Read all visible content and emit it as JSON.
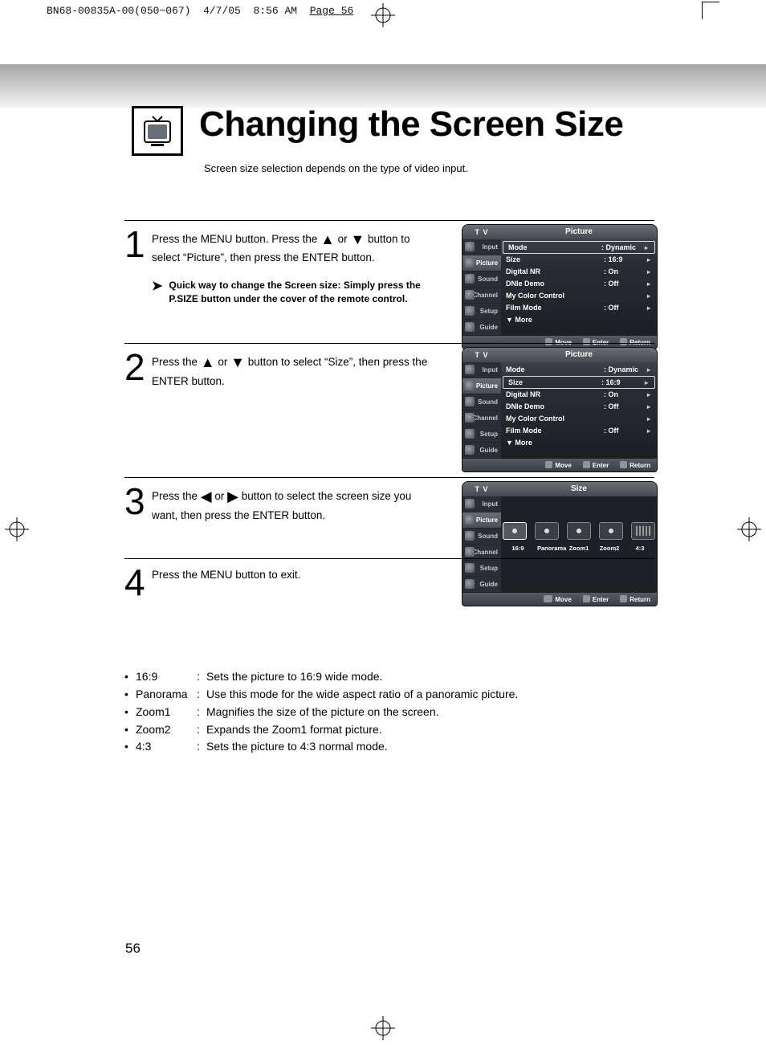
{
  "print_header": {
    "doc": "BN68-00835A-00(050~067)",
    "date": "4/7/05",
    "time": "8:56 AM",
    "page": "Page 56"
  },
  "title": "Changing the Screen Size",
  "subtitle": "Screen size selection depends on the type of video input.",
  "steps": {
    "s1": {
      "num": "1",
      "text_a": "Press the MENU button. Press the ",
      "text_b": " or ",
      "text_c": " button to select “Picture”, then press the ENTER button."
    },
    "tip": "Quick way to change the Screen size: Simply press the P.SIZE button under the cover of the remote control.",
    "s2": {
      "num": "2",
      "text_a": "Press the ",
      "text_b": " or ",
      "text_c": " button to select “Size”, then press the ENTER button."
    },
    "s3": {
      "num": "3",
      "text_a": "Press the ",
      "text_b": " or ",
      "text_c": " button to select the screen size you want, then press the ENTER button."
    },
    "s4": {
      "num": "4",
      "text": "Press the MENU button to exit."
    }
  },
  "osd": {
    "tv": "T V",
    "picture_title": "Picture",
    "size_title": "Size",
    "side": [
      "Input",
      "Picture",
      "Sound",
      "Channel",
      "Setup",
      "Guide"
    ],
    "rows": [
      {
        "lab": "Mode",
        "val": ": Dynamic",
        "chev": "▸"
      },
      {
        "lab": "Size",
        "val": ": 16:9",
        "chev": "▸"
      },
      {
        "lab": "Digital NR",
        "val": ": On",
        "chev": "▸"
      },
      {
        "lab": "DNIe Demo",
        "val": ": Off",
        "chev": "▸"
      },
      {
        "lab": "My Color Control",
        "val": "",
        "chev": "▸"
      },
      {
        "lab": "Film Mode",
        "val": ": Off",
        "chev": "▸"
      },
      {
        "lab": "▼ More",
        "val": "",
        "chev": ""
      }
    ],
    "footer": {
      "move": "Move",
      "enter": "Enter",
      "return": "Return"
    },
    "sizes": [
      "16:9",
      "Panorama",
      "Zoom1",
      "Zoom2",
      "4:3"
    ]
  },
  "bullets": [
    {
      "k": "16:9",
      "d": "Sets the picture to 16:9 wide mode."
    },
    {
      "k": "Panorama",
      "d": "Use this mode for the wide aspect ratio of a panoramic picture."
    },
    {
      "k": "Zoom1",
      "d": "Magnifies the size of the picture on the screen."
    },
    {
      "k": "Zoom2",
      "d": "Expands the Zoom1 format picture."
    },
    {
      "k": "4:3",
      "d": "Sets the picture to 4:3 normal mode."
    }
  ],
  "page_number": "56",
  "glyphs": {
    "up": "▲",
    "down": "▼",
    "left": "◀",
    "right": "▶",
    "tip": "➤"
  }
}
